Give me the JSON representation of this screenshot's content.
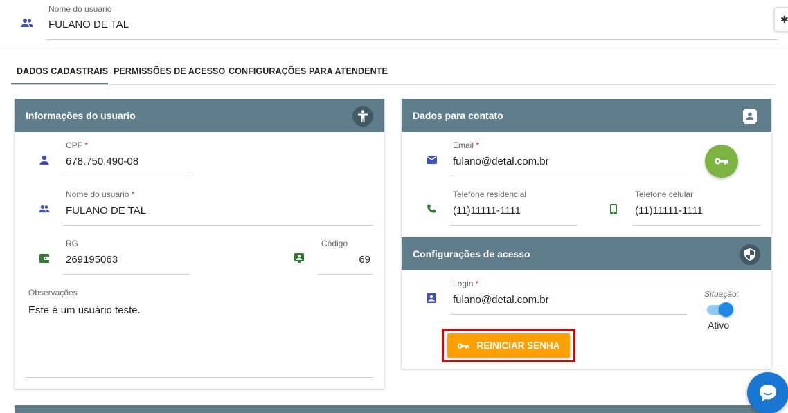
{
  "header": {
    "user_label": "Nome do usuario",
    "user_value": "FULANO DE TAL"
  },
  "tabs": [
    {
      "label": "DADOS CADASTRAIS",
      "active": true
    },
    {
      "label": "PERMISSÕES DE ACESSO",
      "active": false
    },
    {
      "label": "CONFIGURAÇÕES PARA ATENDENTE",
      "active": false
    }
  ],
  "info_card": {
    "title": "Informações do usuario",
    "icon": "accessibility-icon",
    "cpf_label": "CPF",
    "cpf_value": "678.750.490-08",
    "nome_label": "Nome do usuario",
    "nome_value": "FULANO DE TAL",
    "rg_label": "RG",
    "rg_value": "269195063",
    "codigo_label": "Código",
    "codigo_value": "69",
    "obs_label": "Observações",
    "obs_value": "Este é um usuário teste."
  },
  "contato_card": {
    "title": "Dados para contato",
    "icon": "contacts-icon",
    "email_label": "Email",
    "email_value": "fulano@detal.com.br",
    "tel_res_label": "Telefone residencial",
    "tel_res_value": "(11)11111-1111",
    "tel_cel_label": "Telefone celular",
    "tel_cel_value": "(11)11111-1111"
  },
  "acesso_card": {
    "title": "Configurações de acesso",
    "icon": "shield-icon",
    "login_label": "Login",
    "login_value": "fulano@detal.com.br",
    "situacao_label": "Situação:",
    "situacao_value": "Ativo",
    "situacao_on": true,
    "reset_button": "REINICIAR SENHA"
  },
  "colors": {
    "card_header": "#607d8b",
    "accent_blue": "#3f51b5",
    "accent_green": "#2e7d32",
    "key_fab": "#7cb342",
    "reset_button": "#ffa000",
    "highlight": "#e00000",
    "toggle": "#1e88e5"
  }
}
